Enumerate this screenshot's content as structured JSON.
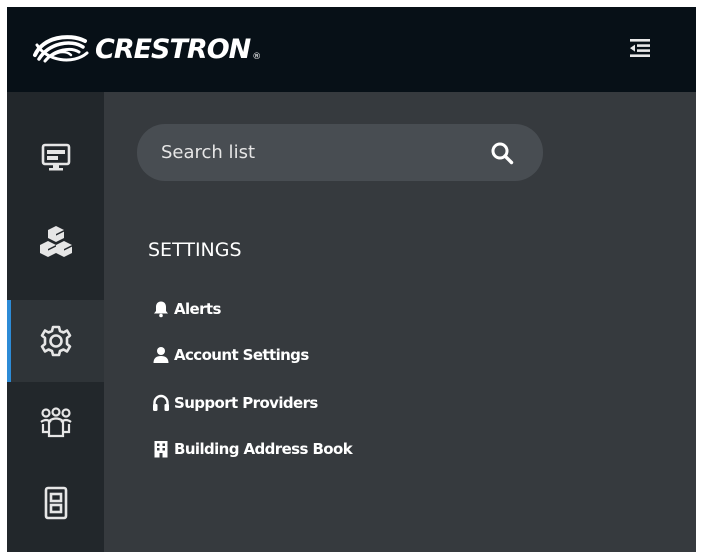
{
  "brand": {
    "name": "CRESTRON",
    "registered": "®"
  },
  "header": {
    "collapse_icon": "menu-collapse-icon"
  },
  "nav_rail": {
    "items": [
      {
        "icon": "display-icon",
        "active": false
      },
      {
        "icon": "cubes-icon",
        "active": false
      },
      {
        "icon": "settings-gear-icon",
        "active": true
      },
      {
        "icon": "group-icon",
        "active": false
      },
      {
        "icon": "cabinet-icon",
        "active": false
      }
    ],
    "active_color": "#2d8bd6"
  },
  "search": {
    "placeholder": "Search list",
    "value": "",
    "icon": "search-icon"
  },
  "settings": {
    "title": "SETTINGS",
    "items": [
      {
        "label": "Alerts",
        "icon": "bell-icon"
      },
      {
        "label": "Account Settings",
        "icon": "user-icon"
      },
      {
        "label": "Support Providers",
        "icon": "headset-icon"
      },
      {
        "label": "Building Address Book",
        "icon": "building-icon"
      }
    ]
  },
  "colors": {
    "header_bg": "#071017",
    "rail_bg": "#22272b",
    "panel_bg": "#363a3e",
    "search_bg": "#484d52"
  }
}
